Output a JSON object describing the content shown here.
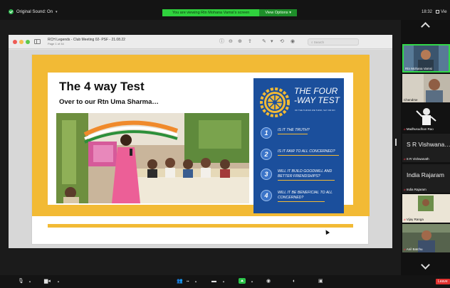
{
  "topbar": {
    "original_sound": "Original Sound: On",
    "viewing_banner": "You are viewing Rtn Mohana Vamsi's screen",
    "view_options": "View Options",
    "clock": "18:32",
    "view_label": "Vie"
  },
  "document": {
    "title": "RCH Legends - Club Meeting 02- PSF - 21.08.22",
    "page": "Page 1 of 34",
    "search_placeholder": "Search"
  },
  "slide": {
    "heading": "The 4 way Test",
    "subheading": "Over to our Rtn Uma Sharma…",
    "panel_title": "THE FOUR -WAY TEST",
    "panel_tagline": "OF THE THINGS WE THINK, SAY OR DO",
    "questions": [
      {
        "num": "1",
        "text": "IS IT THE TRUTH?"
      },
      {
        "num": "2",
        "text": "IS IT FAIR TO ALL CONCERNED?"
      },
      {
        "num": "3",
        "text": "WILL IT BUILD GOODWILL AND BETTER FRIENDSHIPS?"
      },
      {
        "num": "4",
        "text": "WILL IT BE BENEFICIAL TO ALL CONCERNED?"
      }
    ]
  },
  "participants": [
    {
      "name": "Rtn Mohana Vamsi",
      "big": ""
    },
    {
      "name": "Chendrse",
      "big": ""
    },
    {
      "name": "Madhusudhan Rao",
      "big": ""
    },
    {
      "name": "S R Vishwanath",
      "big": "S R Vishwana…"
    },
    {
      "name": "India Rajaram",
      "big": "India Rajaram"
    },
    {
      "name": "Vijay Ranga",
      "big": ""
    },
    {
      "name": "Anil Batchu",
      "big": ""
    }
  ],
  "bottombar": {
    "leave": "Leave"
  },
  "colors": {
    "banner_green": "#2fd13d",
    "slide_yellow": "#f2ba35",
    "panel_blue": "#1b4f9c",
    "leave_red": "#e0312f"
  }
}
